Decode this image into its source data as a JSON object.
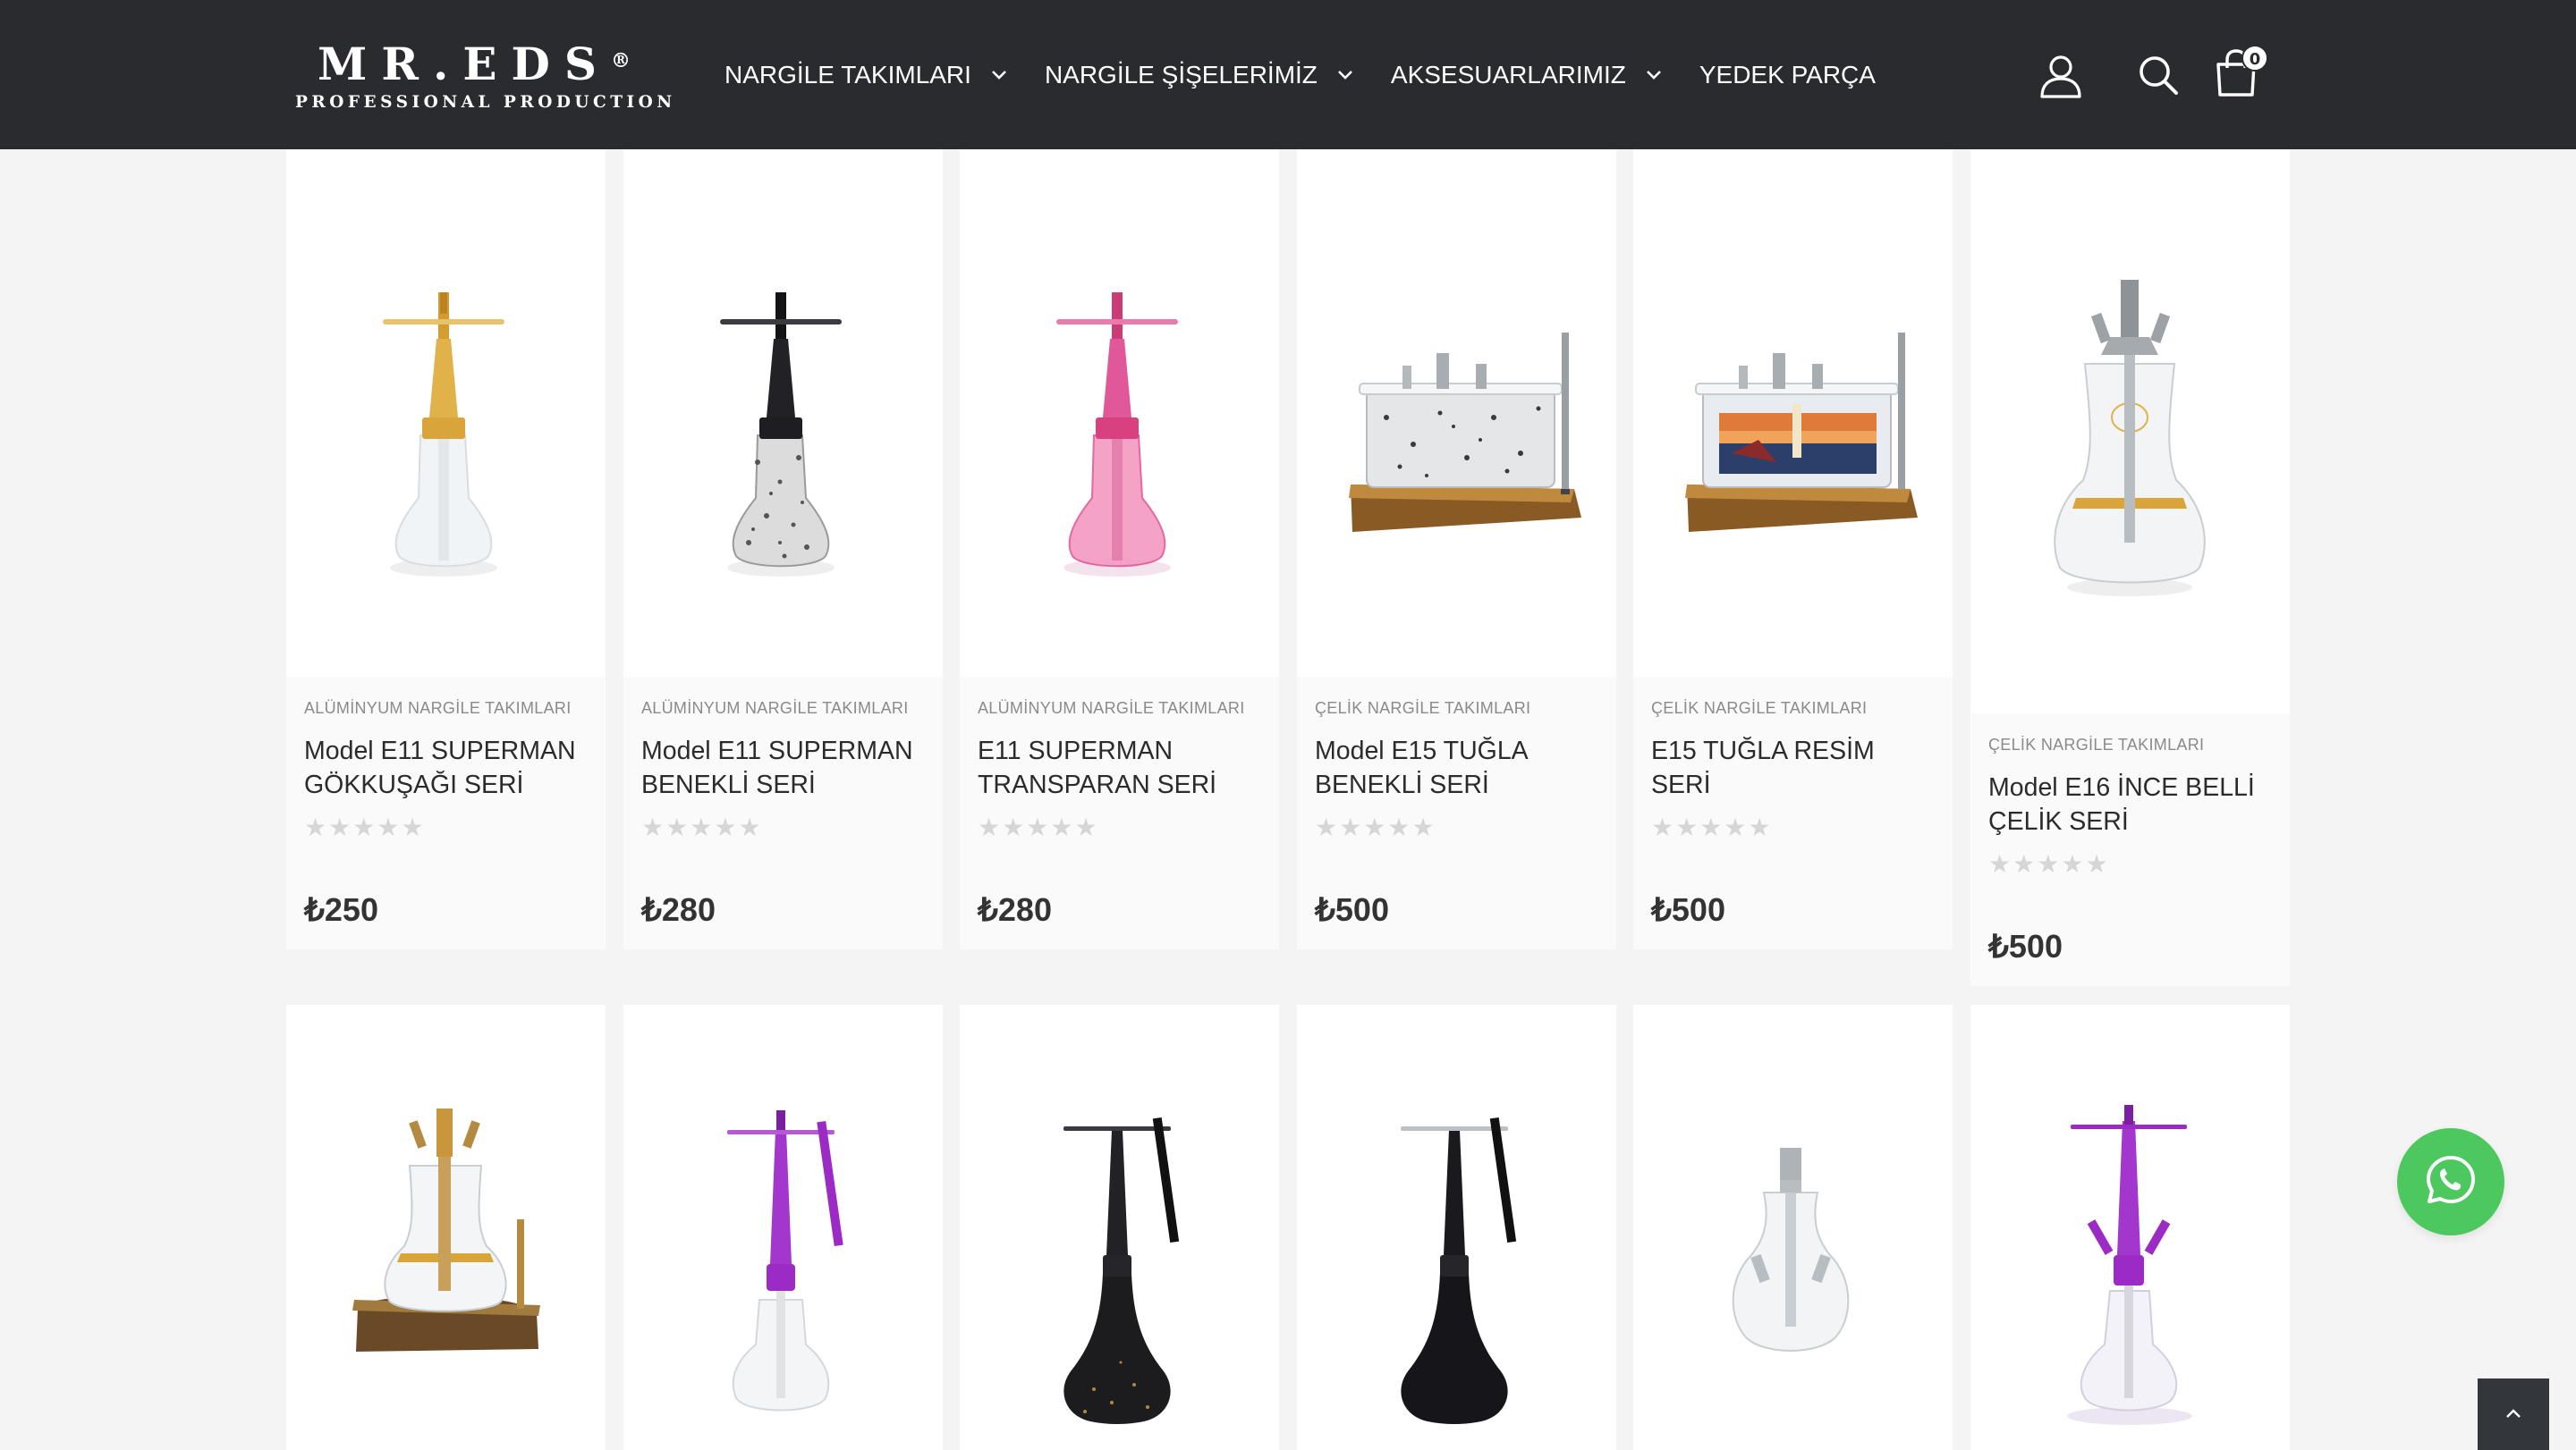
{
  "brand": {
    "name": "MR.EDS",
    "registered_mark": "®",
    "tagline": "PROFESSIONAL PRODUCTION"
  },
  "nav": {
    "items": [
      {
        "label": "NARGİLE TAKIMLARI",
        "has_dropdown": true
      },
      {
        "label": "NARGİLE ŞİŞELERİMİZ",
        "has_dropdown": true
      },
      {
        "label": "AKSESUARLARIMIZ",
        "has_dropdown": true
      },
      {
        "label": "YEDEK PARÇA",
        "has_dropdown": false
      }
    ]
  },
  "header_icons": {
    "account": "user-icon",
    "search": "search-icon",
    "cart": "shopping-bag-icon",
    "cart_count": "0"
  },
  "products": [
    {
      "category": "ALÜMİNYUM NARGİLE TAKIMLARI",
      "name": "Model E11 SUPERMAN GÖKKUŞAĞI SERİ",
      "price": "₺250",
      "rating": 0
    },
    {
      "category": "ALÜMİNYUM NARGİLE TAKIMLARI",
      "name": "Model E11 SUPERMAN BENEKLİ SERİ",
      "price": "₺280",
      "rating": 0
    },
    {
      "category": "ALÜMİNYUM NARGİLE TAKIMLARI",
      "name": "E11 SUPERMAN TRANSPARAN SERİ",
      "price": "₺280",
      "rating": 0
    },
    {
      "category": "ÇELİK NARGİLE TAKIMLARI",
      "name": "Model E15 TUĞLA BENEKLİ SERİ",
      "price": "₺500",
      "rating": 0
    },
    {
      "category": "ÇELİK NARGİLE TAKIMLARI",
      "name": "E15 TUĞLA RESİM SERİ",
      "price": "₺500",
      "rating": 0
    },
    {
      "category": "ÇELİK NARGİLE TAKIMLARI",
      "name": "Model E16 İNCE BELLİ ÇELİK SERİ",
      "price": "₺500",
      "rating": 0
    }
  ],
  "floating": {
    "whatsapp": "whatsapp-icon",
    "back_to_top": "chevron-up-icon"
  },
  "colors": {
    "header_bg": "#2a2b2f",
    "page_bg": "#f4f4f4",
    "whatsapp": "#4cc85f",
    "gold": "#d4a43a",
    "purple": "#9b2bc4",
    "pink": "#e0589a"
  }
}
